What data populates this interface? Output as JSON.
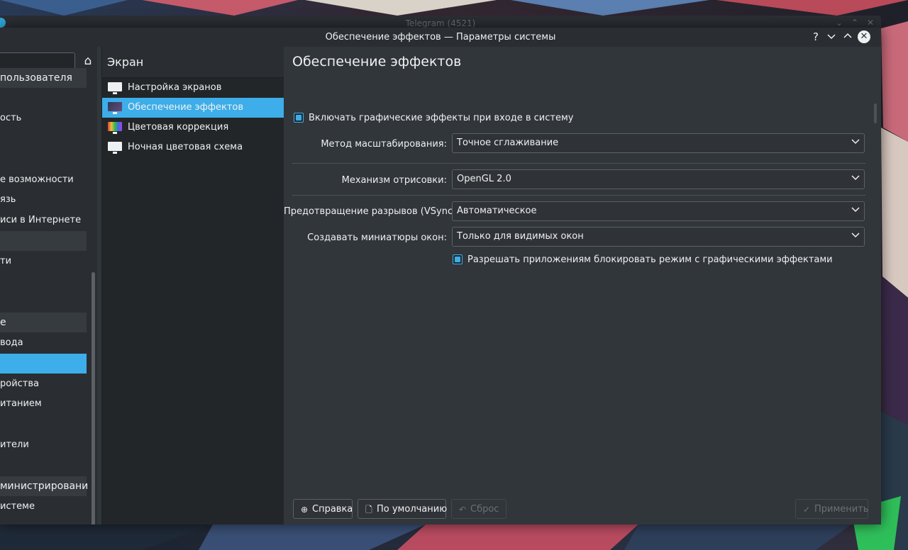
{
  "telegram": {
    "title": "Telegram (4521)"
  },
  "window": {
    "title": "Обеспечение эффектов — Параметры системы"
  },
  "sidebar": {
    "items": [
      {
        "label": "пользователя",
        "type": "cat"
      },
      {
        "label": "",
        "type": "item"
      },
      {
        "label": "ость",
        "type": "item"
      },
      {
        "label": "",
        "type": "item"
      },
      {
        "label": "",
        "type": "item"
      },
      {
        "label": "е возможности",
        "type": "item"
      },
      {
        "label": "язь",
        "type": "item"
      },
      {
        "label": "иси в Интернете",
        "type": "item"
      },
      {
        "label": "",
        "type": "cat"
      },
      {
        "label": "ти",
        "type": "item"
      },
      {
        "label": "",
        "type": "item"
      },
      {
        "label": "",
        "type": "item"
      },
      {
        "label": "е",
        "type": "cat"
      },
      {
        "label": "вода",
        "type": "item"
      },
      {
        "label": "",
        "type": "sel"
      },
      {
        "label": "ройства",
        "type": "item"
      },
      {
        "label": "итанием",
        "type": "item"
      },
      {
        "label": "",
        "type": "item"
      },
      {
        "label": "ители",
        "type": "item"
      },
      {
        "label": "",
        "type": "item"
      },
      {
        "label": "министрировани",
        "type": "cat"
      },
      {
        "label": "истеме",
        "type": "item"
      }
    ]
  },
  "middle": {
    "title": "Экран",
    "items": [
      {
        "label": "Настройка экранов",
        "icon": "monitor-icon"
      },
      {
        "label": "Обеспечение эффектов",
        "icon": "compositor-icon",
        "selected": true
      },
      {
        "label": "Цветовая коррекция",
        "icon": "color-correction-icon"
      },
      {
        "label": "Ночная цветовая схема",
        "icon": "night-color-icon"
      }
    ]
  },
  "content": {
    "title": "Обеспечение эффектов",
    "enable_on_startup": "Включать графические эффекты при входе в систему",
    "scale_method_label": "Метод масштабирования:",
    "scale_method_value": "Точное сглаживание",
    "backend_label": "Механизм отрисовки:",
    "backend_value": "OpenGL 2.0",
    "vsync_label": "Предотвращение разрывов (VSync):",
    "vsync_value": "Автоматическое",
    "thumbnails_label": "Создавать миниатюры окон:",
    "thumbnails_value": "Только для видимых окон",
    "allow_block": "Разрешать приложениям блокировать режим с графическими эффектами"
  },
  "buttons": {
    "help": "Справка",
    "defaults": "По умолчанию",
    "reset": "Сброс",
    "apply": "Применить"
  },
  "colors": {
    "accent": "#3daee9",
    "window_bg": "#31363b",
    "panel_bg": "#232629"
  }
}
